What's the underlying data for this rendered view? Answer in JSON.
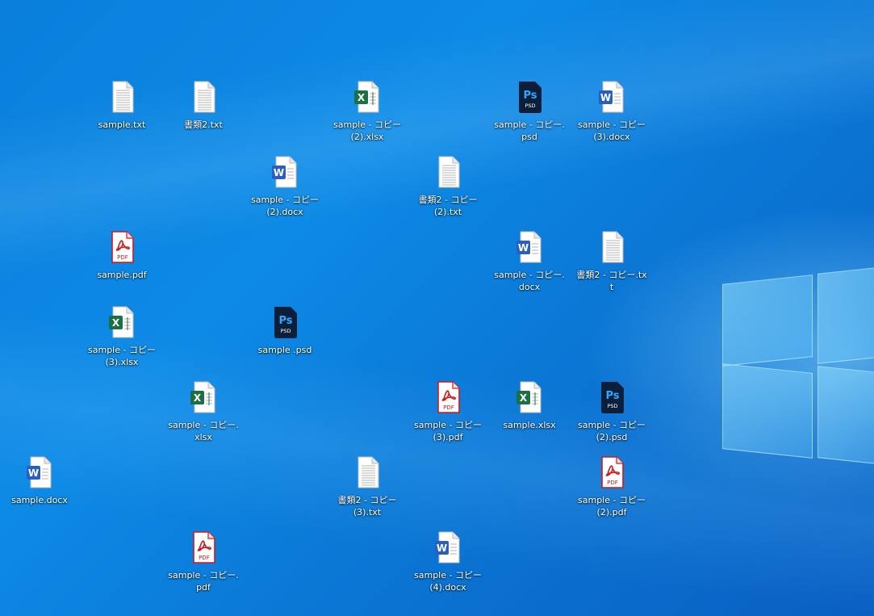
{
  "desktop": {
    "icons": [
      {
        "label": "sample.txt",
        "type": "txt"
      },
      {
        "label": "書類2.txt",
        "type": "txt"
      },
      {
        "label": "sample - コピー\n(2).xlsx",
        "type": "xlsx"
      },
      {
        "label": "sample  - コピー.\npsd",
        "type": "psd"
      },
      {
        "label": "sample - コピー\n(3).docx",
        "type": "docx"
      },
      {
        "label": "sample - コピー\n(2).docx",
        "type": "docx"
      },
      {
        "label": "書類2 - コピー\n(2).txt",
        "type": "txt"
      },
      {
        "label": "sample.pdf",
        "type": "pdf"
      },
      {
        "label": "sample - コピー.\ndocx",
        "type": "docx"
      },
      {
        "label": "書類2 - コピー.txt",
        "type": "txt"
      },
      {
        "label": "sample - コピー\n(3).xlsx",
        "type": "xlsx"
      },
      {
        "label": "sample .psd",
        "type": "psd"
      },
      {
        "label": "sample - コピー.xlsx",
        "type": "xlsx"
      },
      {
        "label": "sample - コピー\n(3).pdf",
        "type": "pdf"
      },
      {
        "label": "sample.xlsx",
        "type": "xlsx"
      },
      {
        "label": "sample  - コピー\n(2).psd",
        "type": "psd"
      },
      {
        "label": "sample.docx",
        "type": "docx"
      },
      {
        "label": "書類2 - コピー\n(3).txt",
        "type": "txt"
      },
      {
        "label": "sample - コピー\n(2).pdf",
        "type": "pdf"
      },
      {
        "label": "sample - コピー.pdf",
        "type": "pdf"
      },
      {
        "label": "sample - コピー\n(4).docx",
        "type": "docx"
      }
    ]
  },
  "icon_glyphs": {
    "txt": "text-file-icon",
    "xlsx": "excel-file-icon",
    "docx": "word-file-icon",
    "pdf": "pdf-file-icon",
    "psd": "photoshop-file-icon"
  },
  "icon_text": {
    "excel": "X",
    "word": "W",
    "ps": "Ps",
    "psd": "PSD",
    "pdf": "PDF"
  },
  "colors": {
    "excel": "#1d7044",
    "word": "#2b5fbd",
    "pdf": "#d0191c",
    "psd": "#0b1f3a",
    "psd_text": "#31a8ff"
  }
}
